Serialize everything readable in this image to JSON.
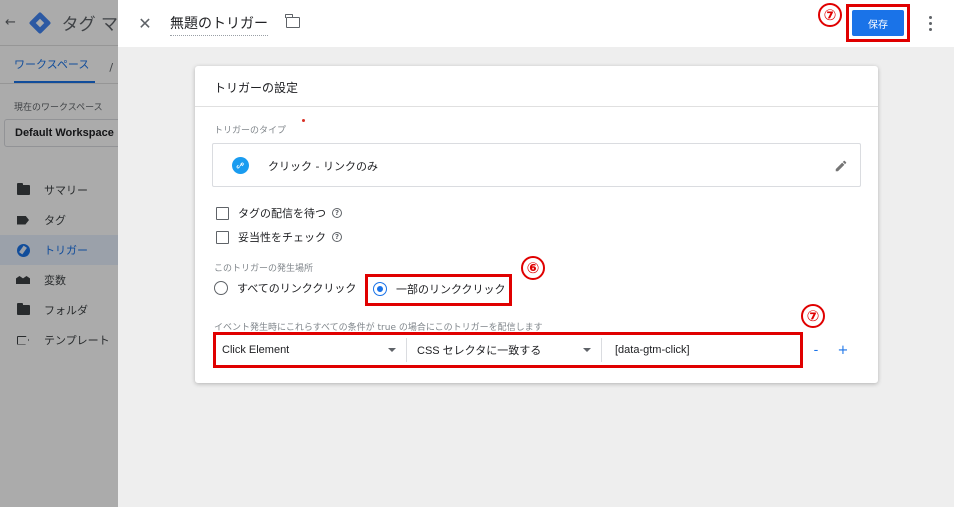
{
  "background_app": {
    "back_icon": "arrow-left-icon",
    "logo_icon": "tag-manager-logo-icon",
    "app_title": "タグ マ",
    "tabs": [
      "ワークスペース",
      "/"
    ],
    "workspace_label": "現在のワークスペース",
    "workspace_name": "Default Workspace",
    "nav": [
      {
        "label": "サマリー",
        "icon": "folder-icon"
      },
      {
        "label": "タグ",
        "icon": "tag-icon"
      },
      {
        "label": "トリガー",
        "icon": "trigger-icon",
        "active": true
      },
      {
        "label": "変数",
        "icon": "variable-icon"
      },
      {
        "label": "フォルダ",
        "icon": "folder-icon"
      },
      {
        "label": "テンプレート",
        "icon": "template-icon"
      }
    ]
  },
  "header": {
    "close_icon": "close-icon",
    "title": "無題のトリガー",
    "folder_icon": "folder-icon",
    "save_label": "保存",
    "more_icon": "more-vert-icon"
  },
  "annotations": {
    "save_marker": "⑦",
    "radio_marker": "⑥",
    "condition_marker": "⑦",
    "highlight_color": "#e00000"
  },
  "card": {
    "title": "トリガーの設定",
    "type_label": "トリガーのタイプ",
    "type_value": "クリック - リンクのみ",
    "type_icon": "link-icon",
    "edit_icon": "pencil-icon",
    "checkboxes": [
      {
        "label": "タグの配信を待つ",
        "checked": false,
        "help_icon": "help-icon"
      },
      {
        "label": "妥当性をチェック",
        "checked": false,
        "help_icon": "help-icon"
      }
    ],
    "fire_label": "このトリガーの発生場所",
    "radios": [
      {
        "label": "すべてのリンククリック",
        "checked": false
      },
      {
        "label": "一部のリンククリック",
        "checked": true
      }
    ],
    "condition_label": "イベント発生時にこれらすべての条件が true の場合にこのトリガーを配信します",
    "condition": {
      "variable": "Click Element",
      "operator": "CSS セレクタに一致する",
      "value": "[data-gtm-click]",
      "remove_label": "-",
      "add_label": "+"
    }
  },
  "colors": {
    "accent": "#1a73e8",
    "link_icon_bg": "#1a9cf0",
    "panel_bg": "#eeeeee"
  }
}
